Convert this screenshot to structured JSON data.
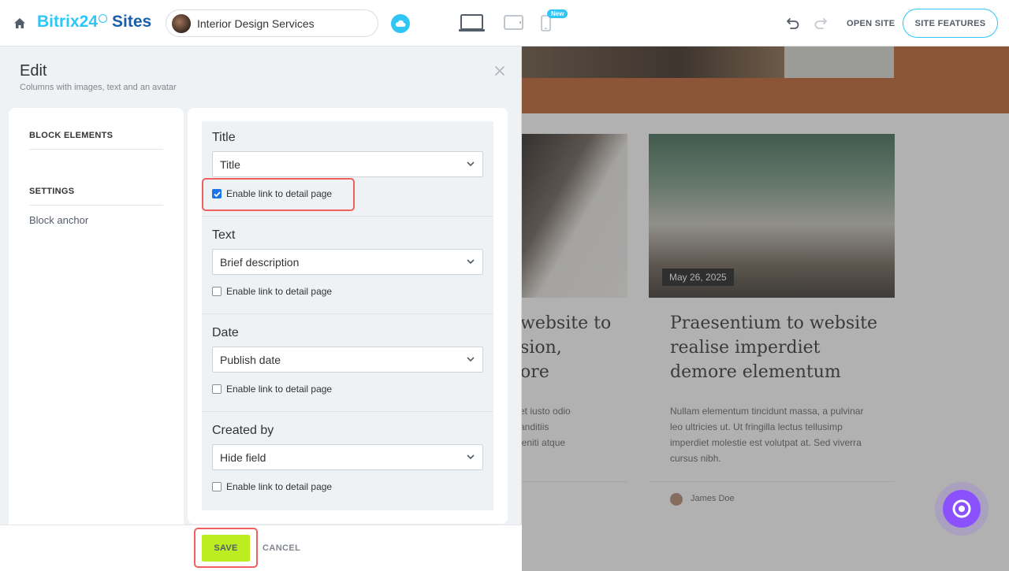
{
  "topbar": {
    "logo_part1": "Bitrix24",
    "logo_part2": "Sites",
    "site_name": "Interior Design Services",
    "new_badge": "New",
    "open_site": "OPEN SITE",
    "site_features": "SITE FEATURES"
  },
  "panel": {
    "title": "Edit",
    "subtitle": "Columns with images, text and an avatar",
    "nav": {
      "block_elements": "BLOCK ELEMENTS",
      "settings": "SETTINGS",
      "block_anchor": "Block anchor"
    },
    "fields": [
      {
        "label": "Title",
        "value": "Title",
        "checkbox": "Enable link to detail page",
        "checked": true
      },
      {
        "label": "Text",
        "value": "Brief description",
        "checkbox": "Enable link to detail page",
        "checked": false
      },
      {
        "label": "Date",
        "value": "Publish date",
        "checkbox": "Enable link to detail page",
        "checked": false
      },
      {
        "label": "Created by",
        "value": "Hide field",
        "checkbox": "Enable link to detail page",
        "checked": false
      }
    ],
    "footer": {
      "save": "SAVE",
      "cancel": "CANCEL"
    }
  },
  "preview": {
    "left_card": {
      "title_lines": [
        "website to",
        "sion,",
        "ore"
      ],
      "text_lines": [
        "et iusto odio",
        "anditiis",
        "leniti atque"
      ]
    },
    "right_card": {
      "date": "May 26, 2025",
      "title_lines": [
        "Praesentium to website",
        "realise imperdiet",
        "demore elementum"
      ],
      "text_lines": [
        "Nullam elementum tincidunt massa, a pulvinar",
        "leo ultricies ut. Ut fringilla lectus tellusimp",
        "imperdiet molestie est volutpat at. Sed viverra",
        "cursus nibh."
      ],
      "author": "James Doe"
    }
  }
}
